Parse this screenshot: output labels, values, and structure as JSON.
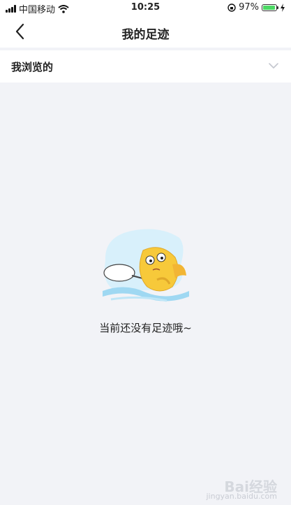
{
  "status": {
    "carrier": "中国移动",
    "time": "10:25",
    "battery": "97%",
    "battery_level": 0.97
  },
  "nav": {
    "title": "我的足迹"
  },
  "filter": {
    "label": "我浏览的"
  },
  "empty": {
    "message": "当前还没有足迹哦~"
  },
  "watermark": {
    "main": "Bai经验",
    "sub": "jingyan.baidu.com"
  },
  "colors": {
    "background": "#f2f3f7",
    "surface": "#ffffff",
    "battery": "#4cd964",
    "fish": "#f7c93a",
    "water": "#bfe6f7"
  }
}
